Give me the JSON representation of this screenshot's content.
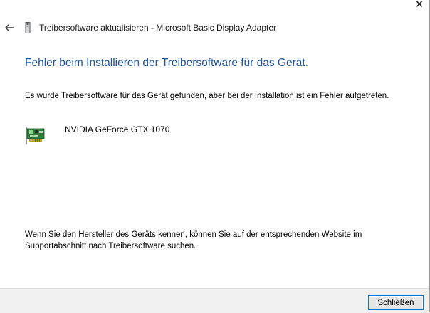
{
  "window": {
    "title": "Treibersoftware aktualisieren - Microsoft Basic Display Adapter",
    "close_glyph": "✕"
  },
  "main": {
    "heading": "Fehler beim Installieren der Treibersoftware für das Gerät.",
    "message": "Es wurde Treibersoftware für das Gerät gefunden, aber bei der Installation ist ein Fehler aufgetreten.",
    "device_name": "NVIDIA GeForce GTX 1070",
    "hint": "Wenn Sie den Hersteller des Geräts kennen, können Sie auf der entsprechenden Website im Supportabschnitt nach Treibersoftware suchen."
  },
  "footer": {
    "close_label": "Schließen"
  },
  "colors": {
    "heading": "#1a55a8",
    "button_border": "#0078d7",
    "footer_bg": "#f0f0f0"
  },
  "icons": {
    "back": "back-arrow-icon",
    "title": "device-manager-icon",
    "device": "graphics-card-icon",
    "close": "close-icon"
  }
}
